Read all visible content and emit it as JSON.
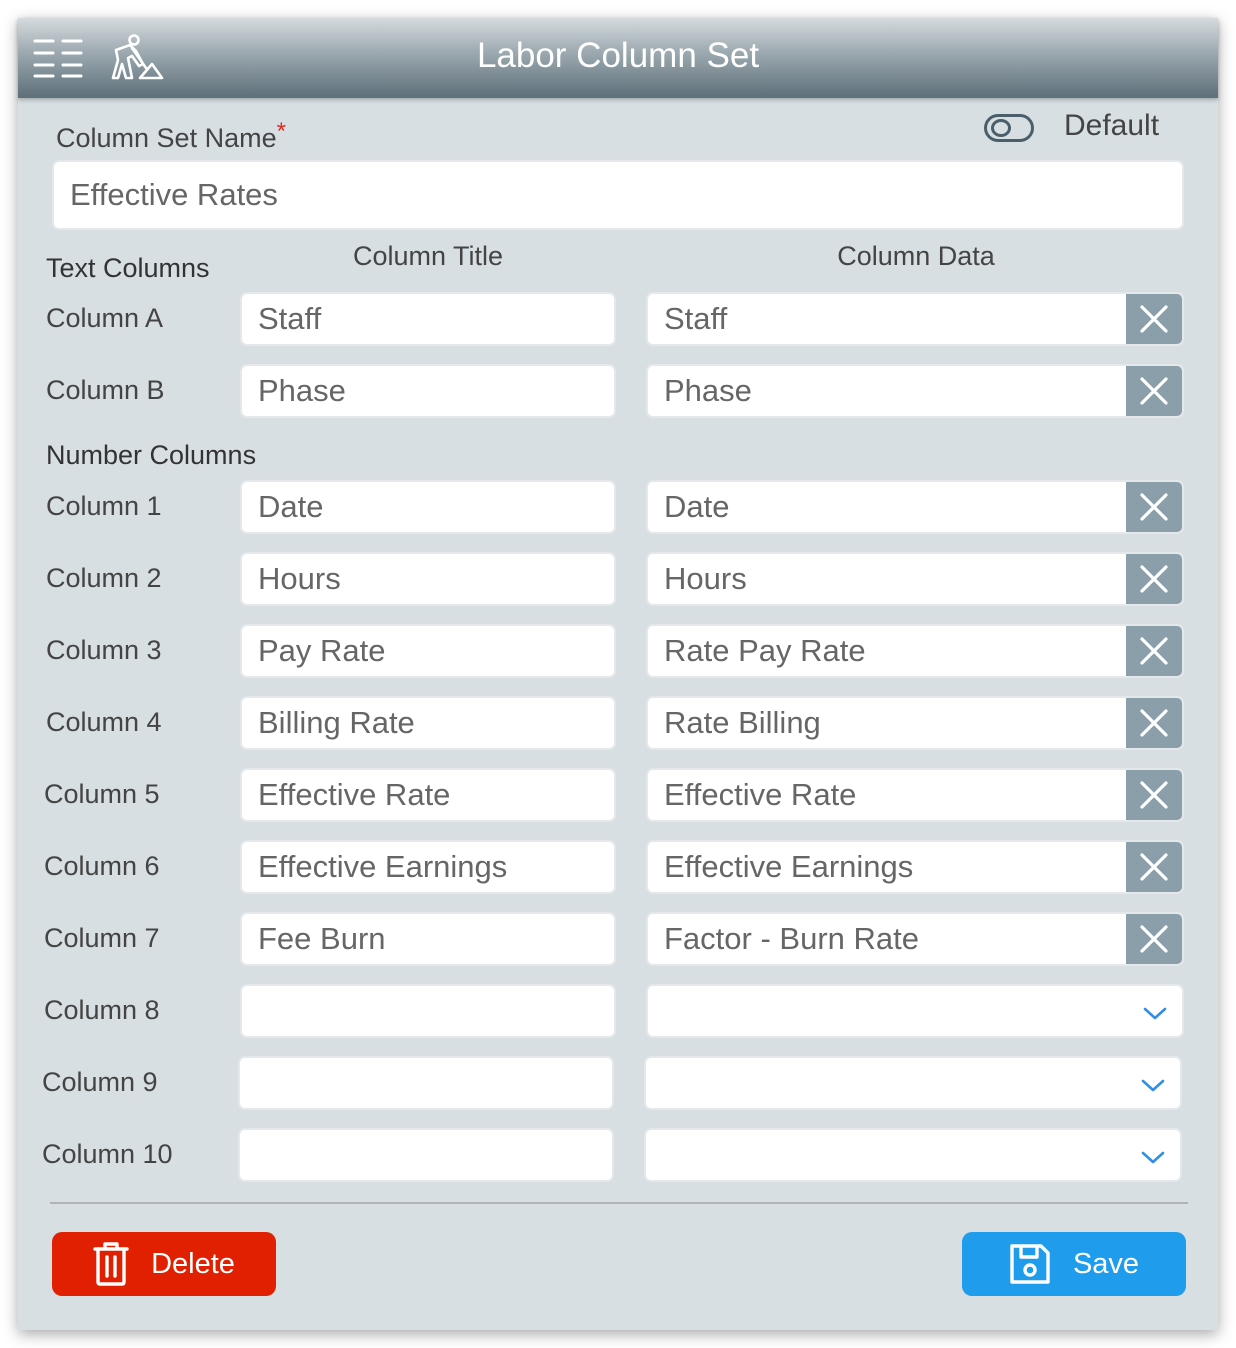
{
  "header": {
    "title": "Labor Column Set",
    "menu_icon": "menu-grid-icon",
    "app_icon": "construction-worker-icon"
  },
  "form": {
    "name_label": "Column Set Name",
    "required_marker": "*",
    "name_value": "Effective Rates",
    "default_label": "Default",
    "default_on": false
  },
  "headers": {
    "text_columns": "Text Columns",
    "number_columns": "Number Columns",
    "column_title": "Column Title",
    "column_data": "Column Data"
  },
  "text_rows": [
    {
      "label": "Column A",
      "title": "Staff",
      "data": "Staff"
    },
    {
      "label": "Column B",
      "title": "Phase",
      "data": "Phase"
    }
  ],
  "number_rows": [
    {
      "label": "Column 1",
      "title": "Date",
      "data": "Date"
    },
    {
      "label": "Column 2",
      "title": "Hours",
      "data": "Hours"
    },
    {
      "label": "Column 3",
      "title": "Pay Rate",
      "data": "Rate Pay Rate"
    },
    {
      "label": "Column 4",
      "title": "Billing Rate",
      "data": "Rate Billing"
    },
    {
      "label": "Column 5",
      "title": "Effective Rate",
      "data": "Effective Rate"
    },
    {
      "label": "Column 6",
      "title": "Effective Earnings",
      "data": "Effective Earnings"
    },
    {
      "label": "Column 7",
      "title": "Fee Burn",
      "data": "Factor - Burn Rate"
    },
    {
      "label": "Column 8",
      "title": "",
      "data": ""
    },
    {
      "label": "Column 9",
      "title": "",
      "data": ""
    },
    {
      "label": "Column 10",
      "title": "",
      "data": ""
    }
  ],
  "buttons": {
    "delete": "Delete",
    "save": "Save"
  },
  "colors": {
    "delete": "#e02000",
    "save": "#209cec",
    "clear_button": "#8a9fa9",
    "chevron": "#2f8fe8",
    "required": "#e8281c"
  }
}
